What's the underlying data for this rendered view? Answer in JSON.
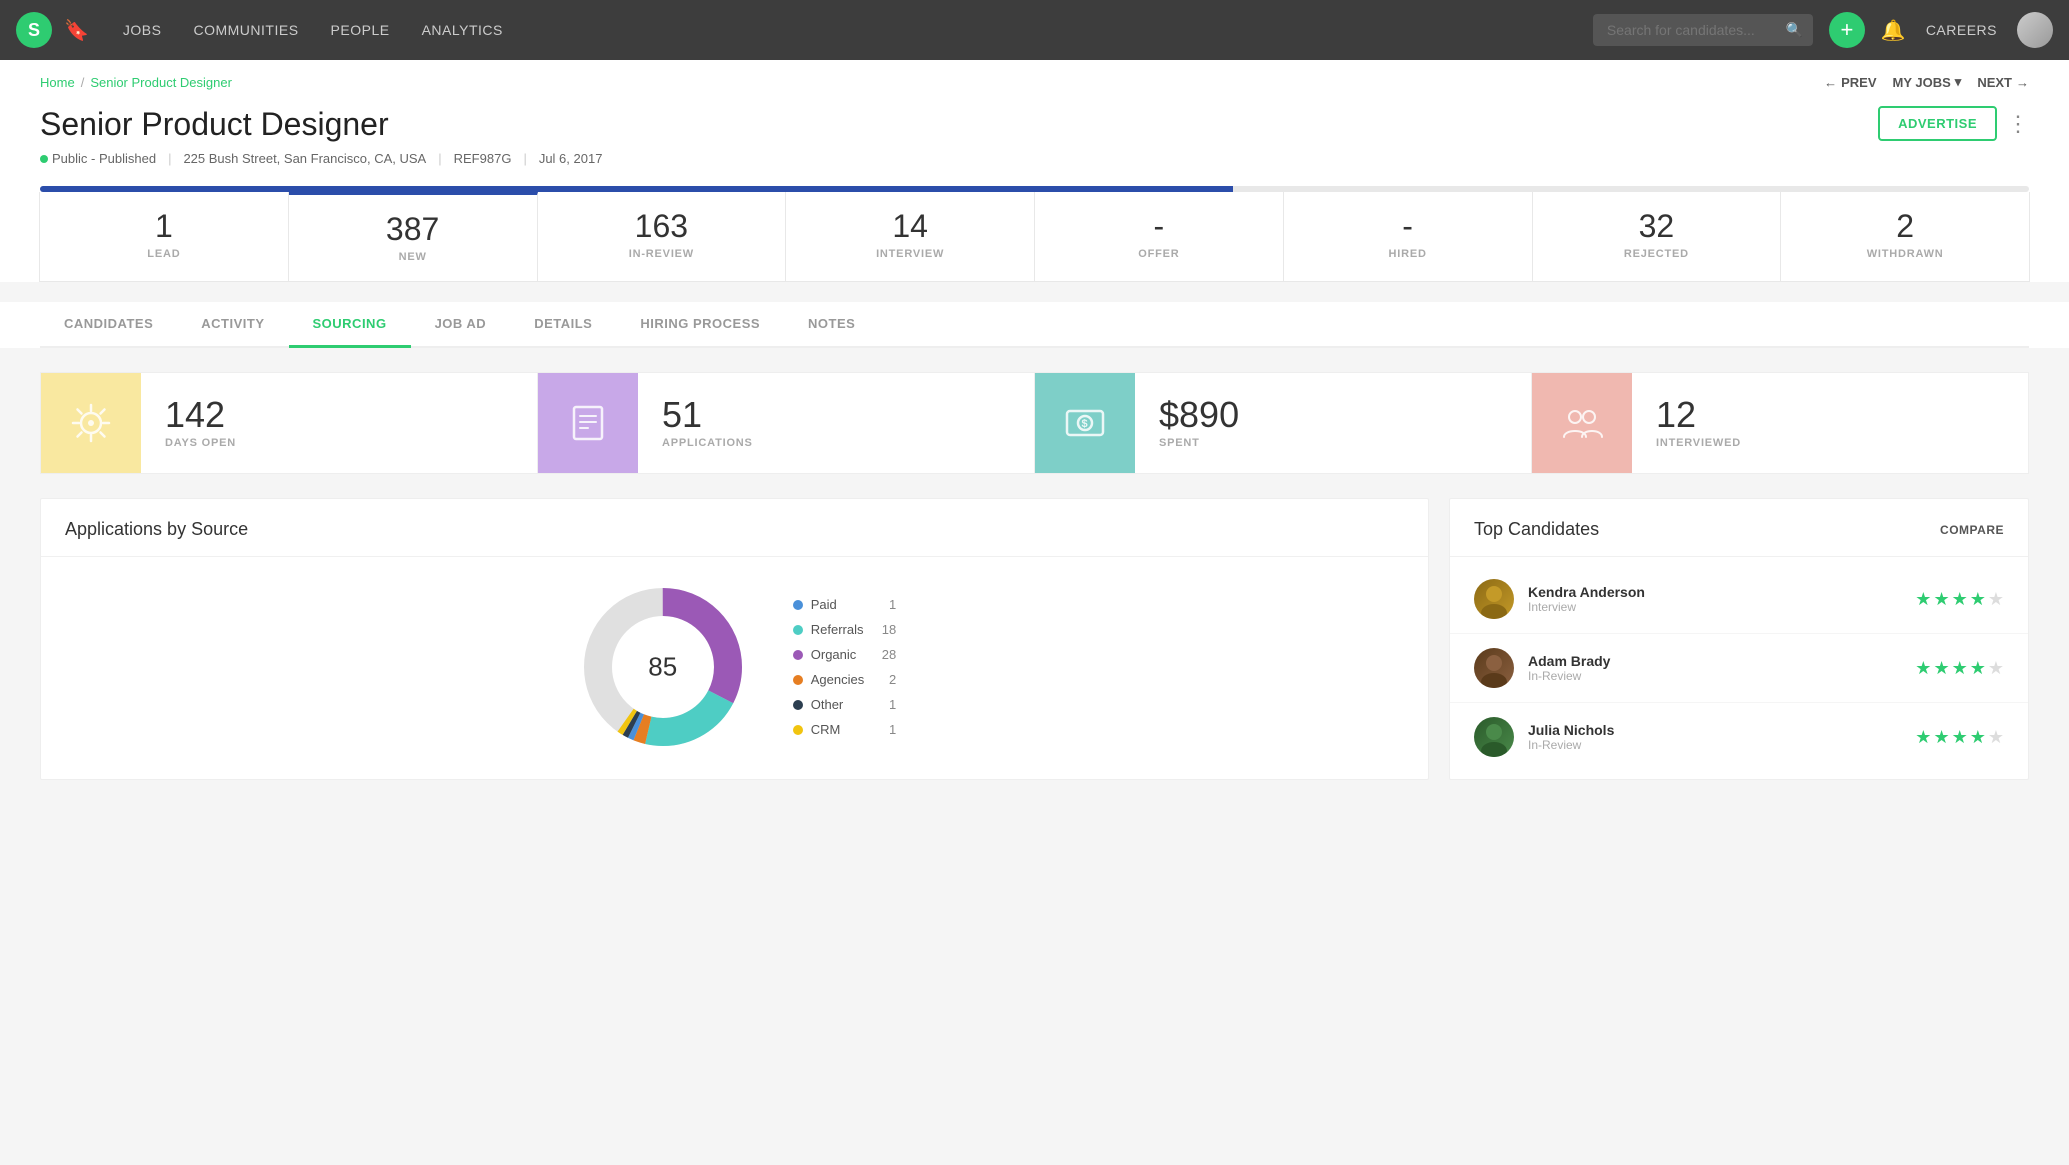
{
  "navbar": {
    "logo": "S",
    "links": [
      "JOBS",
      "COMMUNITIES",
      "PEOPLE",
      "ANALYTICS"
    ],
    "search_placeholder": "Search for candidates...",
    "add_label": "+",
    "careers_label": "CAREERS"
  },
  "breadcrumb": {
    "home": "Home",
    "separator": "/",
    "current": "Senior Product Designer"
  },
  "nav_buttons": {
    "prev": "PREV",
    "myjobs": "MY JOBS",
    "next": "NEXT"
  },
  "job": {
    "title": "Senior Product Designer",
    "status": "Public - Published",
    "location": "225 Bush Street, San Francisco, CA, USA",
    "ref": "REF987G",
    "date": "Jul 6, 2017",
    "advertise_label": "ADVERTISE"
  },
  "stats": [
    {
      "number": "1",
      "label": "LEAD"
    },
    {
      "number": "387",
      "label": "NEW"
    },
    {
      "number": "163",
      "label": "IN-REVIEW"
    },
    {
      "number": "14",
      "label": "INTERVIEW"
    },
    {
      "number": "-",
      "label": "OFFER"
    },
    {
      "number": "-",
      "label": "HIRED"
    },
    {
      "number": "32",
      "label": "REJECTED"
    },
    {
      "number": "2",
      "label": "WITHDRAWN"
    }
  ],
  "tabs": [
    {
      "label": "CANDIDATES",
      "active": false
    },
    {
      "label": "ACTIVITY",
      "active": false
    },
    {
      "label": "SOURCING",
      "active": true
    },
    {
      "label": "JOB AD",
      "active": false
    },
    {
      "label": "DETAILS",
      "active": false
    },
    {
      "label": "HIRING PROCESS",
      "active": false
    },
    {
      "label": "NOTES",
      "active": false
    }
  ],
  "sourcing_cards": [
    {
      "number": "142",
      "label": "DAYS OPEN",
      "icon_color": "yellow"
    },
    {
      "number": "51",
      "label": "APPLICATIONS",
      "icon_color": "purple"
    },
    {
      "number": "$890",
      "label": "SPENT",
      "icon_color": "teal"
    },
    {
      "number": "12",
      "label": "INTERVIEWED",
      "icon_color": "pink"
    }
  ],
  "applications_chart": {
    "title": "Applications by Source",
    "total": "85",
    "legend": [
      {
        "label": "Paid",
        "count": "1",
        "color": "#4a90d9"
      },
      {
        "label": "Referrals",
        "count": "18",
        "color": "#4ecdc4"
      },
      {
        "label": "Organic",
        "count": "28",
        "color": "#9b59b6"
      },
      {
        "label": "Agencies",
        "count": "2",
        "color": "#e67e22"
      },
      {
        "label": "Other",
        "count": "1",
        "color": "#2c3e50"
      },
      {
        "label": "CRM",
        "count": "1",
        "color": "#f1c40f"
      }
    ]
  },
  "top_candidates": {
    "title": "Top Candidates",
    "compare_label": "COMPARE",
    "candidates": [
      {
        "name": "Kendra Anderson",
        "stage": "Interview",
        "stars": 4,
        "avatar_class": "avatar-ka"
      },
      {
        "name": "Adam Brady",
        "stage": "In-Review",
        "stars": 4,
        "avatar_class": "avatar-ab"
      },
      {
        "name": "Julia Nichols",
        "stage": "In-Review",
        "stars": 4,
        "avatar_class": "avatar-jn"
      }
    ]
  }
}
